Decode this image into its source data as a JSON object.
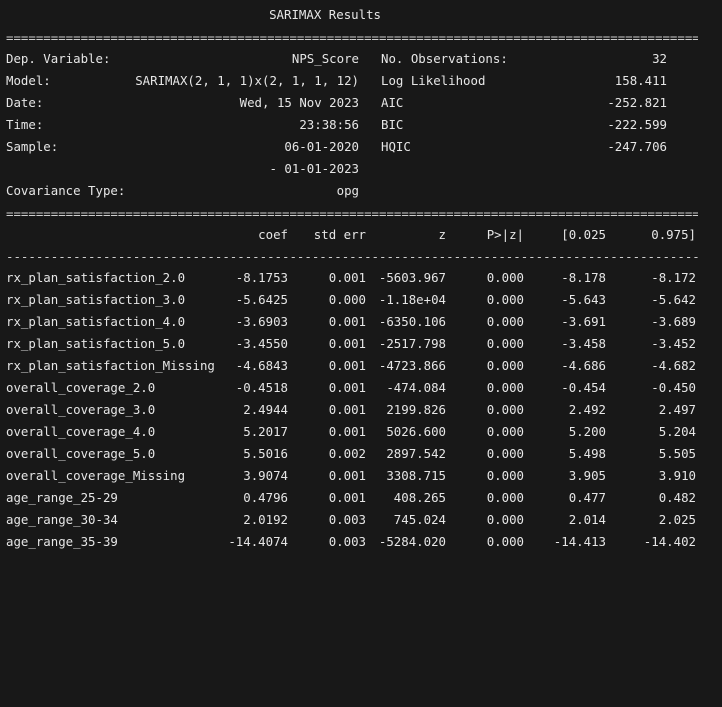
{
  "title": "SARIMAX Results",
  "double_rule": "============================================================================================================================",
  "single_rule": "----------------------------------------------------------------------------------------------------------------------------",
  "info_rows": [
    {
      "label": "Dep. Variable:",
      "value": "NPS_Score",
      "stat_label": "No. Observations:",
      "stat_value": "32"
    },
    {
      "label": "Model:",
      "value": "SARIMAX(2, 1, 1)x(2, 1, 1, 12)",
      "stat_label": "Log Likelihood",
      "stat_value": "158.411"
    },
    {
      "label": "Date:",
      "value": "Wed, 15 Nov 2023",
      "stat_label": "AIC",
      "stat_value": "-252.821"
    },
    {
      "label": "Time:",
      "value": "23:38:56",
      "stat_label": "BIC",
      "stat_value": "-222.599"
    },
    {
      "label": "Sample:",
      "value": "06-01-2020",
      "stat_label": "HQIC",
      "stat_value": "-247.706"
    },
    {
      "label": "",
      "value": "- 01-01-2023",
      "stat_label": "",
      "stat_value": ""
    },
    {
      "label": "Covariance Type:",
      "value": "opg",
      "stat_label": "",
      "stat_value": ""
    }
  ],
  "coef_header": [
    "coef",
    "std err",
    "z",
    "P>|z|",
    "[0.025",
    "0.975]"
  ],
  "coef_rows": [
    [
      "rx_plan_satisfaction_2.0",
      "-8.1753",
      "0.001",
      "-5603.967",
      "0.000",
      "-8.178",
      "-8.172"
    ],
    [
      "rx_plan_satisfaction_3.0",
      "-5.6425",
      "0.000",
      "-1.18e+04",
      "0.000",
      "-5.643",
      "-5.642"
    ],
    [
      "rx_plan_satisfaction_4.0",
      "-3.6903",
      "0.001",
      "-6350.106",
      "0.000",
      "-3.691",
      "-3.689"
    ],
    [
      "rx_plan_satisfaction_5.0",
      "-3.4550",
      "0.001",
      "-2517.798",
      "0.000",
      "-3.458",
      "-3.452"
    ],
    [
      "rx_plan_satisfaction_Missing",
      "-4.6843",
      "0.001",
      "-4723.866",
      "0.000",
      "-4.686",
      "-4.682"
    ],
    [
      "overall_coverage_2.0",
      "-0.4518",
      "0.001",
      "-474.084",
      "0.000",
      "-0.454",
      "-0.450"
    ],
    [
      "overall_coverage_3.0",
      "2.4944",
      "0.001",
      "2199.826",
      "0.000",
      "2.492",
      "2.497"
    ],
    [
      "overall_coverage_4.0",
      "5.2017",
      "0.001",
      "5026.600",
      "0.000",
      "5.200",
      "5.204"
    ],
    [
      "overall_coverage_5.0",
      "5.5016",
      "0.002",
      "2897.542",
      "0.000",
      "5.498",
      "5.505"
    ],
    [
      "overall_coverage_Missing",
      "3.9074",
      "0.001",
      "3308.715",
      "0.000",
      "3.905",
      "3.910"
    ],
    [
      "age_range_25-29",
      "0.4796",
      "0.001",
      "408.265",
      "0.000",
      "0.477",
      "0.482"
    ],
    [
      "age_range_30-34",
      "2.0192",
      "0.003",
      "745.024",
      "0.000",
      "2.014",
      "2.025"
    ],
    [
      "age_range_35-39",
      "-14.4074",
      "0.003",
      "-5284.020",
      "0.000",
      "-14.413",
      "-14.402"
    ]
  ]
}
